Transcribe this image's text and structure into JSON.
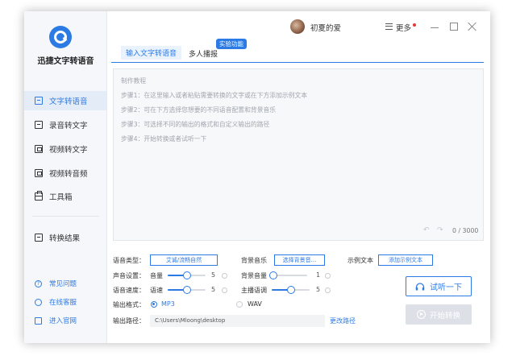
{
  "app": {
    "title": "迅捷文字转语音"
  },
  "nav": {
    "items": [
      {
        "label": "文字转语音",
        "icon": "text-icon",
        "active": true
      },
      {
        "label": "录音转文字",
        "icon": "record-icon"
      },
      {
        "label": "视频转文字",
        "icon": "video-text-icon"
      },
      {
        "label": "视频转音频",
        "icon": "video-audio-icon"
      },
      {
        "label": "工具箱",
        "icon": "toolbox-icon"
      }
    ],
    "results": "转换结果"
  },
  "help": {
    "faq": "常见问题",
    "service": "在线客服",
    "site": "进入官网"
  },
  "titlebar": {
    "username": "初夏的爱",
    "more": "更多"
  },
  "tabs": {
    "tab1": "输入文字转语音",
    "tab2": "多人播报",
    "badge": "实验功能"
  },
  "editor": {
    "tutorial_title": "制作教程",
    "steps": [
      "步骤1：在这里输入或者粘贴需要转换的文字或在下方添加示例文本",
      "步骤2：可在下方选择您想要的不同语音配置和背景音乐",
      "步骤3：可选择不同的输出的格式和自定义输出的路径",
      "步骤4：开始转换或者试听一下"
    ],
    "counter": "0 / 3000"
  },
  "settings": {
    "voice_type_label": "语音类型：",
    "voice_type_value": "艾诚/流畅自然",
    "bg_music_label": "背景音乐",
    "bg_music_button": "选择背景音...",
    "example_label": "示例文本",
    "example_button": "添加示例文本",
    "sound_label": "声音设置：",
    "volume_label": "音量",
    "volume_value": "5",
    "bg_volume_label": "背景音量",
    "bg_volume_value": "1",
    "speed_label": "语音速度：",
    "rate_label": "语速",
    "rate_value": "5",
    "pitch_label": "主播语调",
    "pitch_value": "5",
    "format_label": "输出格式：",
    "format_mp3": "MP3",
    "format_wav": "WAV",
    "path_label": "输出路径：",
    "path_value": "C:\\Users\\Mloong\\desktop",
    "change_path": "更改路径",
    "listen_button": "试听一下",
    "start_button": "开始转换",
    "levels": {
      "volume": 0.5,
      "bg_volume": 0.1,
      "rate": 0.5,
      "pitch": 0.5
    },
    "selected_format": "MP3"
  },
  "colors": {
    "accent": "#2c7be5",
    "sidebar_bg": "#f5f7fb",
    "disabled": "#dde1e7"
  }
}
